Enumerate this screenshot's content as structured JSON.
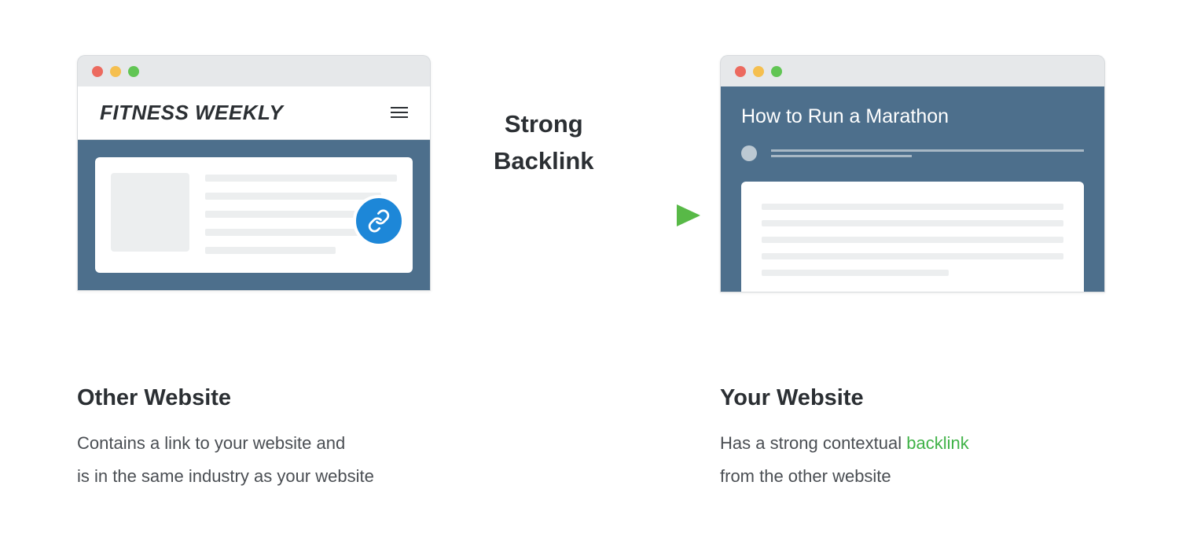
{
  "center_label": {
    "line1": "Strong",
    "line2": "Backlink"
  },
  "left_window": {
    "site_title": "FITNESS WEEKLY"
  },
  "right_window": {
    "article_title": "How to Run a Marathon"
  },
  "left_desc": {
    "title": "Other Website",
    "body_line1": "Contains a link to your website and",
    "body_line2": "is in the same industry as your website"
  },
  "right_desc": {
    "title": "Your Website",
    "body_prefix": "Has a strong contextual ",
    "body_highlight": "backlink",
    "body_line2": "from the other website"
  },
  "colors": {
    "blue": "#1d87d8",
    "green": "#58b947",
    "teal_bg": "#4d6f8c"
  }
}
